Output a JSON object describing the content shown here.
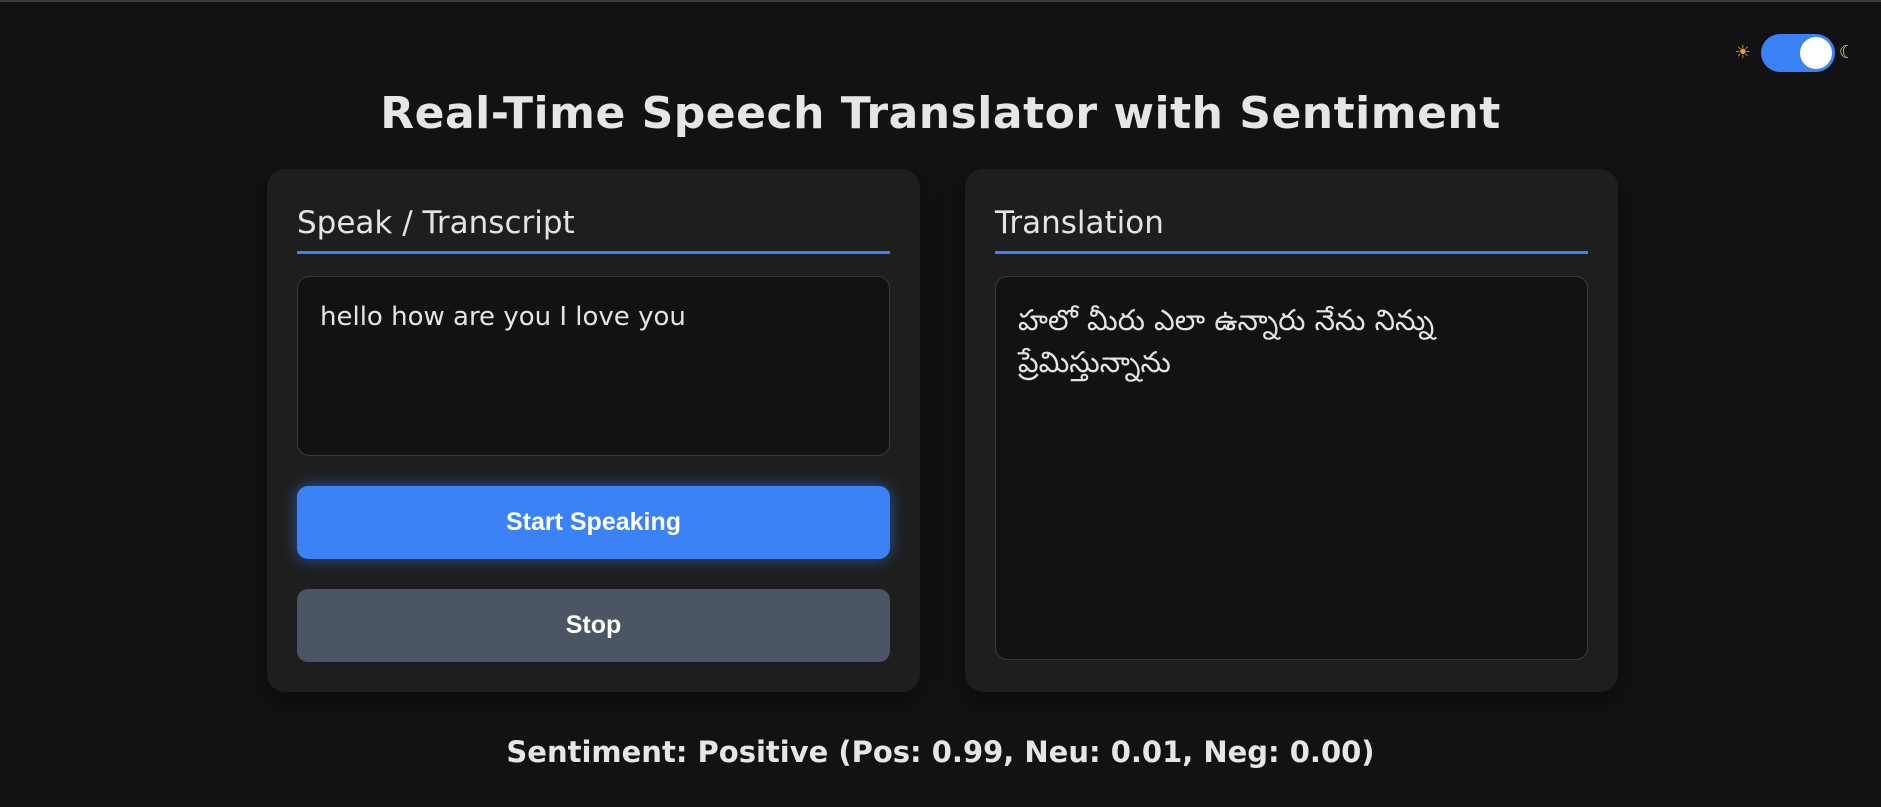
{
  "title": "Real-Time Speech Translator with Sentiment",
  "theme_toggle": {
    "sun_icon": "☀",
    "moon_icon": "☾",
    "state": "dark"
  },
  "transcript_panel": {
    "header": "Speak / Transcript",
    "text": "hello how are you I love you",
    "start_button_label": "Start Speaking",
    "stop_button_label": "Stop"
  },
  "translation_panel": {
    "header": "Translation",
    "text": "హలో మీరు ఎలా ఉన్నారు నేను నిన్ను ప్రేమిస్తున్నాను"
  },
  "sentiment": "Sentiment: Positive (Pos: 0.99, Neu: 0.01, Neg: 0.00)",
  "colors": {
    "background": "#121212",
    "card": "#1e1e1e",
    "accent": "#3b82f6",
    "stop_button": "#4b5563"
  }
}
